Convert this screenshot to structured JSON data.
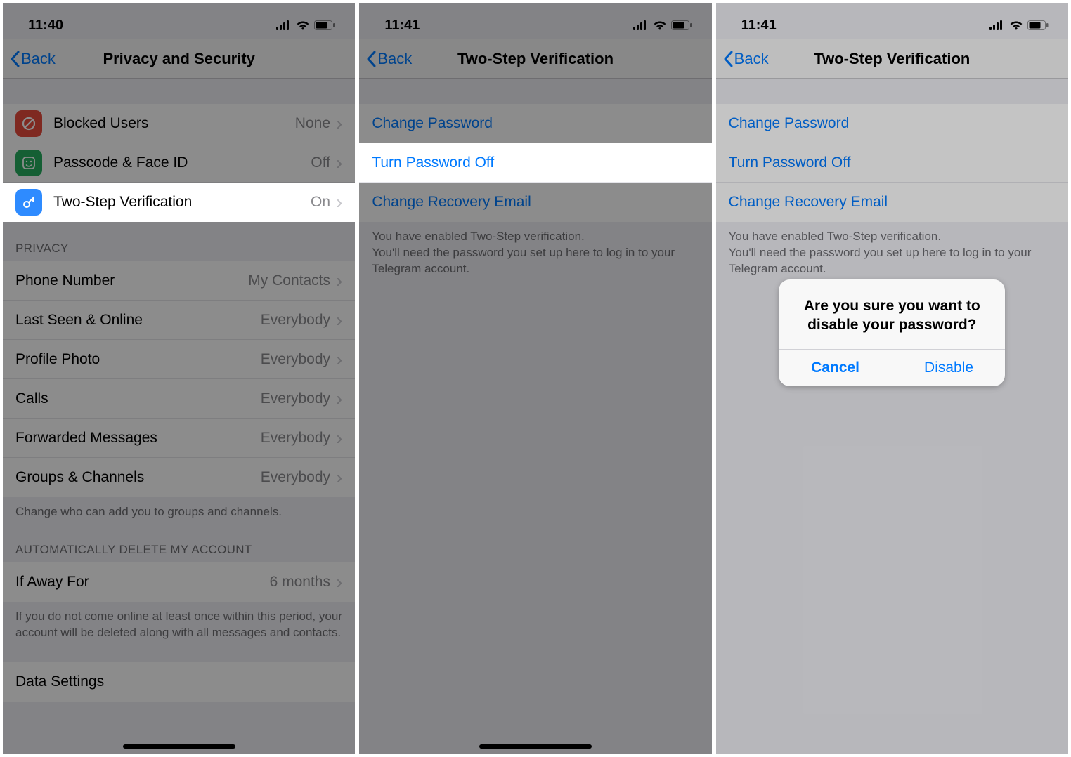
{
  "status": {
    "time1": "11:40",
    "time2": "11:41",
    "time3": "11:41"
  },
  "screen1": {
    "back": "Back",
    "title": "Privacy and Security",
    "security": [
      {
        "label": "Blocked Users",
        "value": "None"
      },
      {
        "label": "Passcode & Face ID",
        "value": "Off"
      },
      {
        "label": "Two-Step Verification",
        "value": "On"
      }
    ],
    "privacy_header": "PRIVACY",
    "privacy": [
      {
        "label": "Phone Number",
        "value": "My Contacts"
      },
      {
        "label": "Last Seen & Online",
        "value": "Everybody"
      },
      {
        "label": "Profile Photo",
        "value": "Everybody"
      },
      {
        "label": "Calls",
        "value": "Everybody"
      },
      {
        "label": "Forwarded Messages",
        "value": "Everybody"
      },
      {
        "label": "Groups & Channels",
        "value": "Everybody"
      }
    ],
    "privacy_footer": "Change who can add you to groups and channels.",
    "delete_header": "AUTOMATICALLY DELETE MY ACCOUNT",
    "delete_row": {
      "label": "If Away For",
      "value": "6 months"
    },
    "delete_footer": "If you do not come online at least once within this period, your account will be deleted along with all messages and contacts.",
    "data_settings_label": "Data Settings"
  },
  "screen2": {
    "back": "Back",
    "title": "Two-Step Verification",
    "rows": [
      "Change Password",
      "Turn Password Off",
      "Change Recovery Email"
    ],
    "footer": "You have enabled Two-Step verification.\nYou'll need the password you set up here to log in to your Telegram account."
  },
  "screen3": {
    "back": "Back",
    "title": "Two-Step Verification",
    "rows": [
      "Change Password",
      "Turn Password Off",
      "Change Recovery Email"
    ],
    "footer": "You have enabled Two-Step verification.\nYou'll need the password you set up here to log in to your Telegram account.",
    "alert_title": "Are you sure you want to disable your password?",
    "alert_cancel": "Cancel",
    "alert_disable": "Disable"
  }
}
